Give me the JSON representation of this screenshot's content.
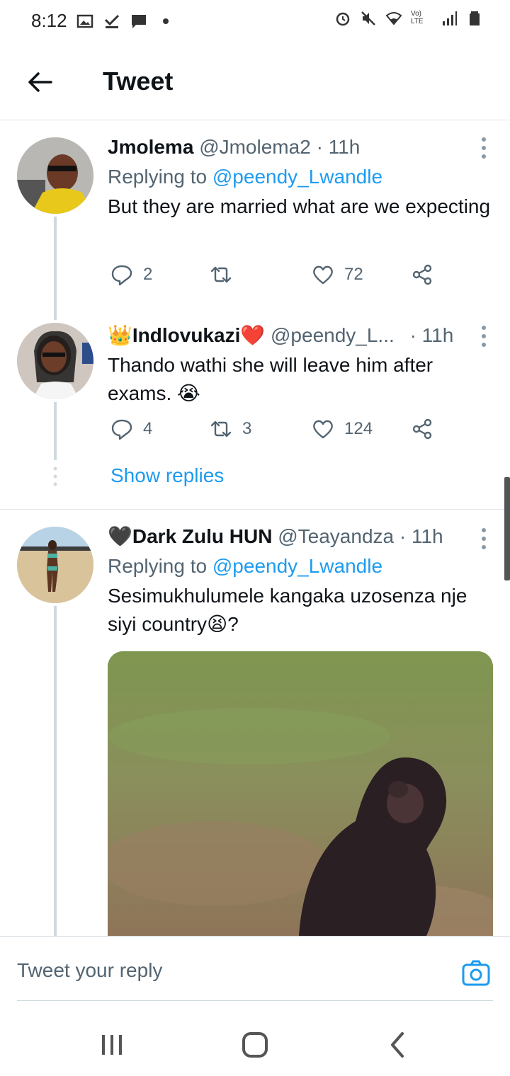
{
  "status_bar": {
    "time": "8:12",
    "network_label": "Vo) LTE"
  },
  "header": {
    "title": "Tweet"
  },
  "tweets": [
    {
      "name": "Jmolema",
      "handle": "@Jmolema2",
      "time": "· 11h",
      "replying_label": "Replying to",
      "replying_to": "@peendy_Lwandle",
      "text": "But they are married what are we expecting",
      "replies": "2",
      "retweets": "",
      "likes": "72"
    },
    {
      "name_prefix": "👑",
      "name": "Indlovukazi",
      "name_suffix": "❤️",
      "handle": "@peendy_L...",
      "time": "· 11h",
      "text": "Thando wathi she will leave him after exams. 😭",
      "replies": "4",
      "retweets": "3",
      "likes": "124",
      "show_replies": "Show replies"
    },
    {
      "name_prefix": "🖤",
      "name": "Dark Zulu HUN",
      "handle": "@Teayandza",
      "time": "· 11h",
      "replying_label": "Replying to",
      "replying_to": "@peendy_Lwandle",
      "text": "Sesimukhulumele kangaka uzosenza nje siyi country😫?"
    }
  ],
  "reply_bar": {
    "placeholder": "Tweet your reply"
  },
  "colors": {
    "accent": "#1d9bf0",
    "muted": "#536471",
    "like": "#536471",
    "divider": "#e1e6ea"
  },
  "icons": [
    "back-arrow-icon",
    "more-icon",
    "reply-icon",
    "retweet-icon",
    "like-icon",
    "share-icon",
    "camera-icon",
    "recents-icon",
    "home-icon",
    "back-icon"
  ]
}
